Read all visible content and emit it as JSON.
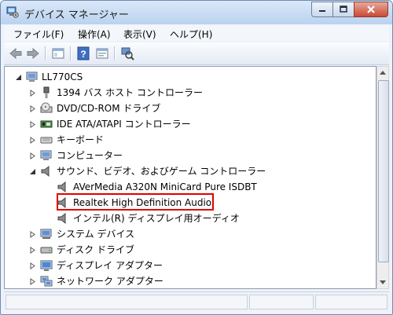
{
  "window": {
    "title": "デバイス マネージャー"
  },
  "menu": {
    "items": [
      "ファイル(F)",
      "操作(A)",
      "表示(V)",
      "ヘルプ(H)"
    ]
  },
  "toolbar": {
    "buttons": [
      "back",
      "forward",
      "show-hide-console-tree",
      "help",
      "properties",
      "scan-hardware"
    ]
  },
  "tree": {
    "root": "LL770CS",
    "items": [
      {
        "label": "1394 バス ホスト コントローラー",
        "icon": "usb-plug-icon",
        "level": 1,
        "expanded": false
      },
      {
        "label": "DVD/CD-ROM ドライブ",
        "icon": "disc-drive-icon",
        "level": 1,
        "expanded": false
      },
      {
        "label": "IDE ATA/ATAPI コントローラー",
        "icon": "ide-controller-icon",
        "level": 1,
        "expanded": false
      },
      {
        "label": "キーボード",
        "icon": "keyboard-icon",
        "level": 1,
        "expanded": false
      },
      {
        "label": "コンピューター",
        "icon": "computer-icon",
        "level": 1,
        "expanded": false
      },
      {
        "label": "サウンド、ビデオ、およびゲーム コントローラー",
        "icon": "speaker-icon",
        "level": 1,
        "expanded": true
      },
      {
        "label": "AVerMedia A320N MiniCard Pure ISDBT",
        "icon": "speaker-icon",
        "level": 2
      },
      {
        "label": "Realtek High Definition Audio",
        "icon": "speaker-icon",
        "level": 2,
        "highlighted": true
      },
      {
        "label": "インテル(R) ディスプレイ用オーディオ",
        "icon": "speaker-icon",
        "level": 2
      },
      {
        "label": "システム デバイス",
        "icon": "system-device-icon",
        "level": 1,
        "expanded": false
      },
      {
        "label": "ディスク ドライブ",
        "icon": "disk-drive-icon",
        "level": 1,
        "expanded": false
      },
      {
        "label": "ディスプレイ アダプター",
        "icon": "display-adapter-icon",
        "level": 1,
        "expanded": false
      },
      {
        "label": "ネットワーク アダプター",
        "icon": "network-adapter-icon",
        "level": 1,
        "expanded": false
      }
    ]
  },
  "colors": {
    "highlight_border": "#e00000",
    "title_bar": "#bad2ef"
  }
}
